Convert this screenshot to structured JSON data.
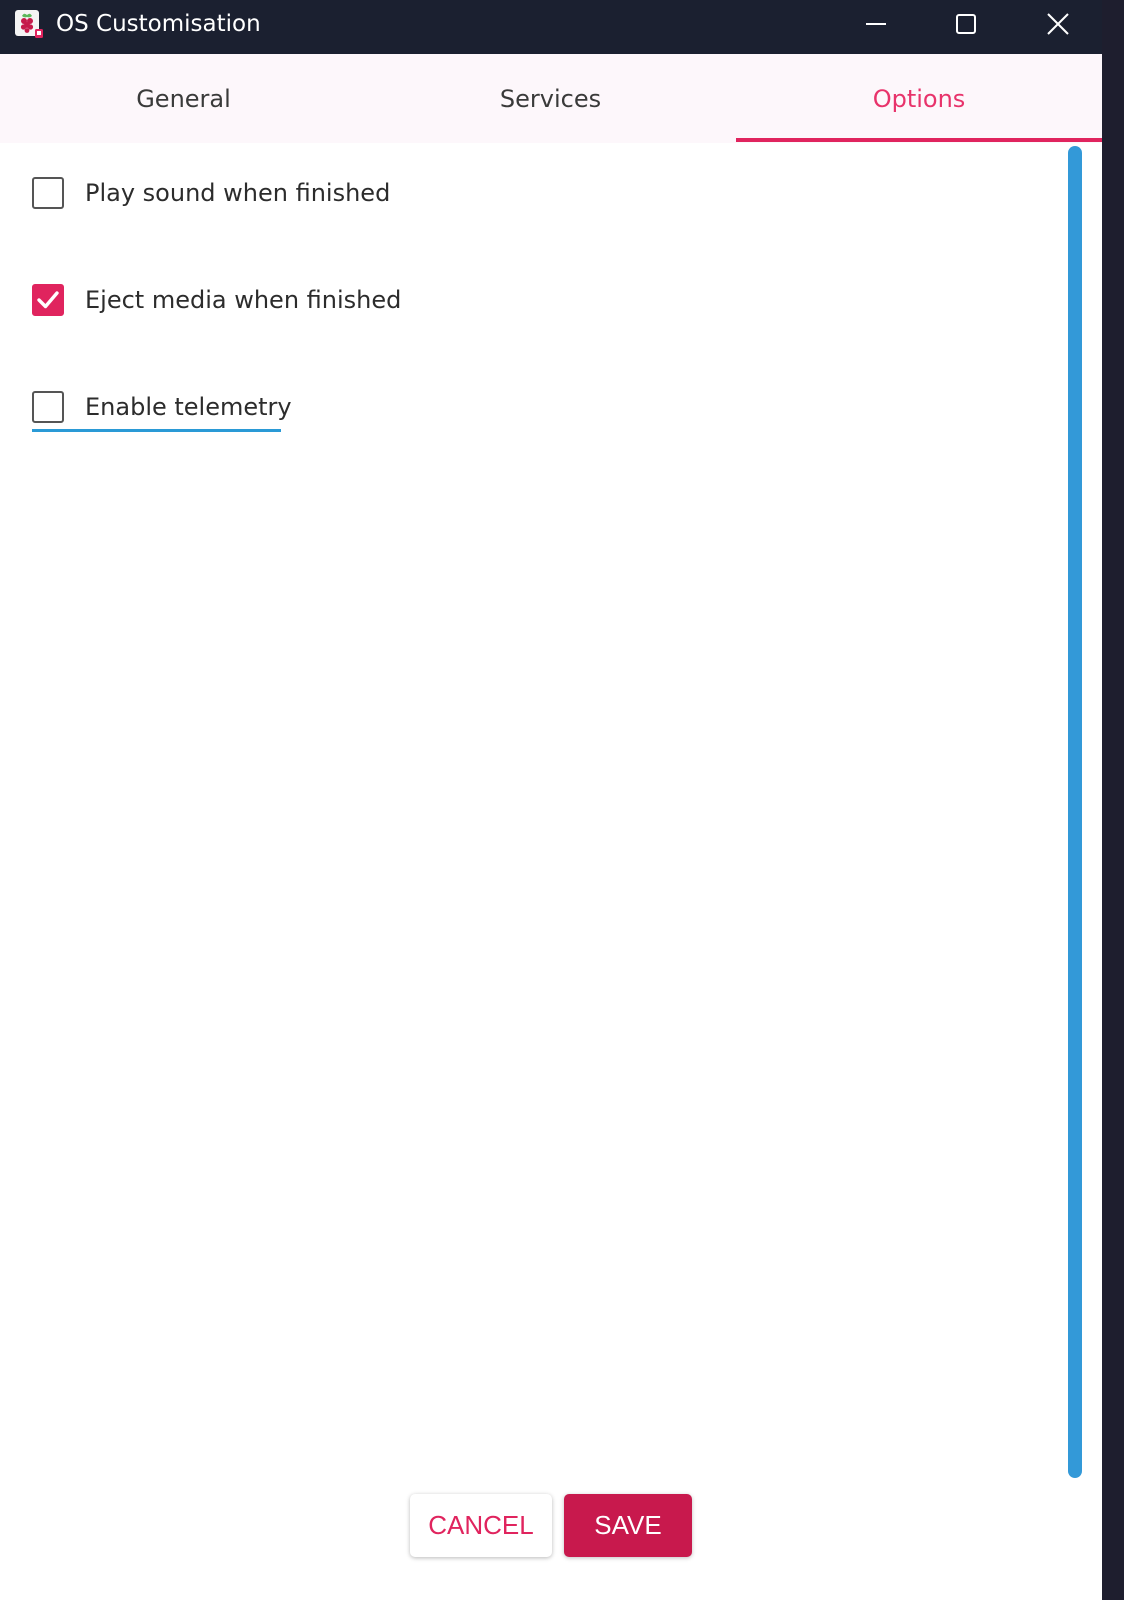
{
  "window": {
    "title": "OS Customisation",
    "icons": {
      "app": "raspberry-pi-icon",
      "minimize": "minimize-icon",
      "maximize": "maximize-icon",
      "close": "close-icon"
    }
  },
  "tabs": [
    {
      "label": "General",
      "active": false
    },
    {
      "label": "Services",
      "active": false
    },
    {
      "label": "Options",
      "active": true
    }
  ],
  "options": [
    {
      "label": "Play sound when finished",
      "checked": false
    },
    {
      "label": "Eject media when finished",
      "checked": true
    },
    {
      "label": "Enable telemetry",
      "checked": false,
      "focused": true
    }
  ],
  "buttons": {
    "cancel": "CANCEL",
    "save": "SAVE"
  },
  "colors": {
    "accent": "#e0245e",
    "titlebar": "#1b2030",
    "tabbar": "#fdf7fb",
    "scrollbar": "#3399d8",
    "focus": "#2a9ad6",
    "save_button": "#c8194d"
  }
}
